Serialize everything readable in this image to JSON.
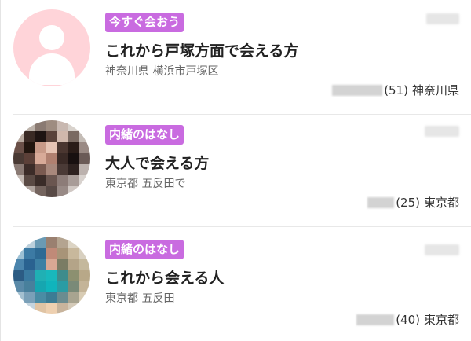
{
  "posts": [
    {
      "badge": "今すぐ会おう",
      "title": "これから戸塚方面で会える方",
      "location": "神奈川県 横浜市戸塚区",
      "age": "(51)",
      "prefecture": "神奈川県",
      "avatar": "default-user-icon",
      "avatar_bg": "#ffd4d9"
    },
    {
      "badge": "内緒のはなし",
      "title": "大人で会える方",
      "location": "東京都 五反田で",
      "age": "(25)",
      "prefecture": "東京都",
      "avatar": "pixelated-profile-photo"
    },
    {
      "badge": "内緒のはなし",
      "title": "これから会える人",
      "location": "東京都 五反田",
      "age": "(40)",
      "prefecture": "東京都",
      "avatar": "pixelated-profile-photo"
    }
  ],
  "colors": {
    "badge": "#c96be0",
    "title": "#222222",
    "subtext": "#666666",
    "divider": "#e8e8e8"
  }
}
